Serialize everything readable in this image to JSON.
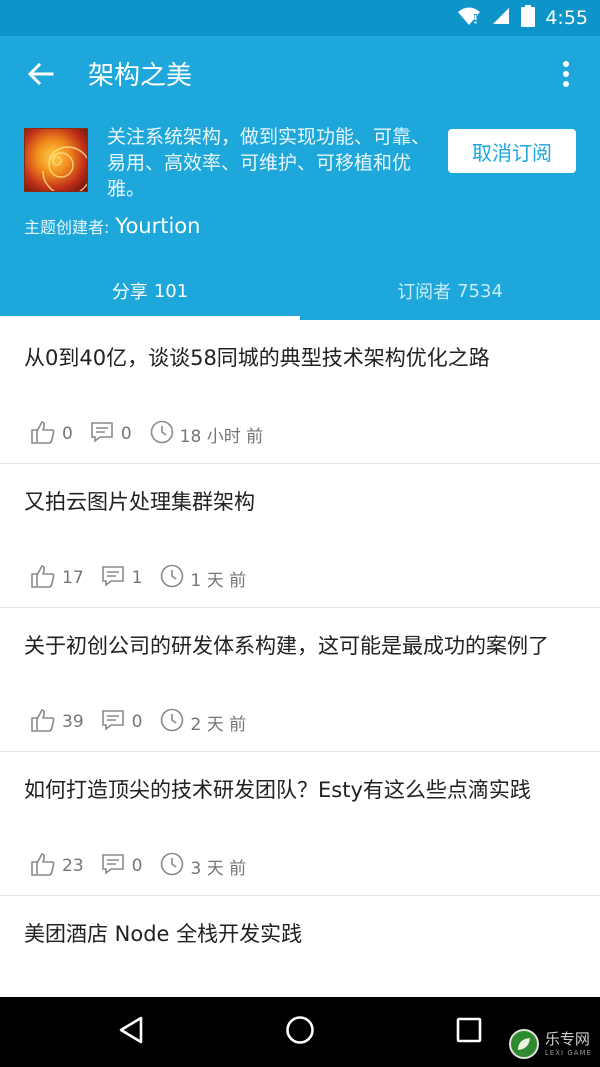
{
  "status_bar": {
    "time": "4:55",
    "icons": [
      "wifi-icon",
      "signal-icon",
      "battery-icon"
    ]
  },
  "header": {
    "title": "架构之美",
    "back_icon": "arrow-left-icon",
    "menu_icon": "more-vertical-icon",
    "topic_description": "关注系统架构，做到实现功能、可靠、易用、高效率、可维护、可移植和优雅。",
    "unsubscribe_label": "取消订阅",
    "creator_label": "主题创建者:",
    "creator_name": "Yourtion",
    "colors": {
      "primary": "#1ea7db",
      "status_bar": "#0d94c9"
    }
  },
  "tabs": [
    {
      "label": "分享",
      "count": "101",
      "active": true
    },
    {
      "label": "订阅者",
      "count": "7534",
      "active": false
    }
  ],
  "feed": [
    {
      "title": "从0到40亿，谈谈58同城的典型技术架构优化之路",
      "likes": "0",
      "comments": "0",
      "time": "18 小时 前"
    },
    {
      "title": "又拍云图片处理集群架构",
      "likes": "17",
      "comments": "1",
      "time": "1 天 前"
    },
    {
      "title": "关于初创公司的研发体系构建，这可能是最成功的案例了",
      "likes": "39",
      "comments": "0",
      "time": "2 天 前"
    },
    {
      "title": "如何打造顶尖的技术研发团队？Esty有这么些点滴实践",
      "likes": "23",
      "comments": "0",
      "time": "3 天 前"
    },
    {
      "title": "美团酒店 Node 全栈开发实践",
      "likes": "",
      "comments": "",
      "time": ""
    }
  ],
  "nav_bar": {
    "buttons": [
      "back-triangle-icon",
      "home-circle-icon",
      "recents-square-icon"
    ]
  },
  "watermark": {
    "title": "乐专网",
    "subtitle": "LEXI GAME"
  }
}
